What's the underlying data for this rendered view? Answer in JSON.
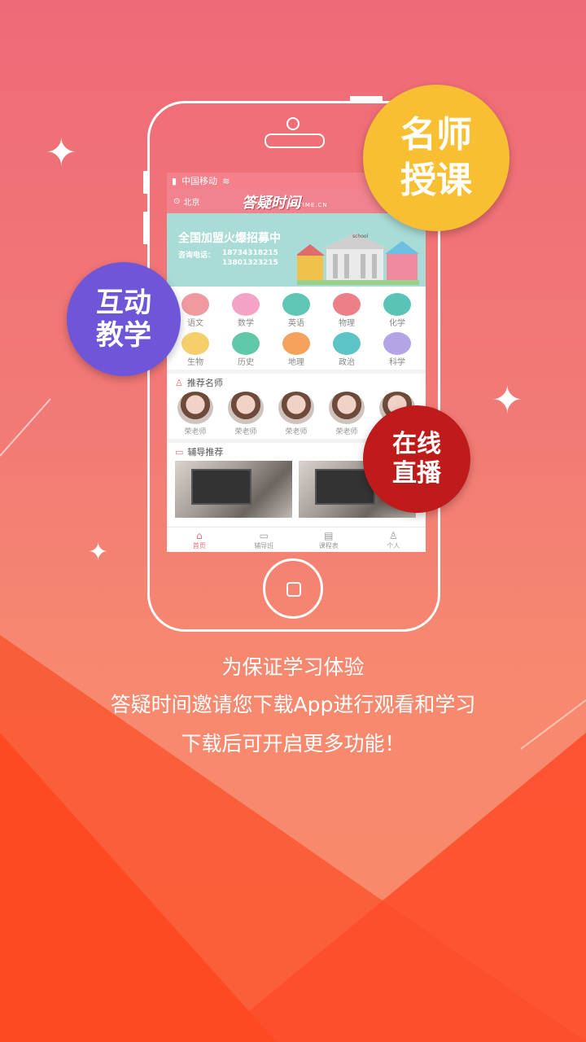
{
  "phone": {
    "status": {
      "carrier": "中国移动"
    },
    "header": {
      "city": "北京",
      "logo": "答疑时间",
      "logo_sub": "DATIME.CN"
    },
    "banner": {
      "title": "全国加盟火爆招募中",
      "phone_label": "咨询电话：",
      "phone1": "18734318215",
      "phone2": "13801323215",
      "school_label": "school"
    },
    "subjects": [
      {
        "label": "语文",
        "color": "#f09aa0"
      },
      {
        "label": "数学",
        "color": "#f4a3c6"
      },
      {
        "label": "英语",
        "color": "#5fc6b6"
      },
      {
        "label": "物理",
        "color": "#ec7f87"
      },
      {
        "label": "化学",
        "color": "#5bc3b6"
      },
      {
        "label": "生物",
        "color": "#f4cf6c"
      },
      {
        "label": "历史",
        "color": "#61c7a9"
      },
      {
        "label": "地理",
        "color": "#f4a25c"
      },
      {
        "label": "政治",
        "color": "#5cc4c6"
      },
      {
        "label": "科学",
        "color": "#b3a4e6"
      }
    ],
    "teachers_section": {
      "title": "推荐名师"
    },
    "teachers": [
      "荣老师",
      "荣老师",
      "荣老师",
      "荣老师",
      "荣老师"
    ],
    "tutor_section": {
      "title": "辅导推荐"
    },
    "tabs": [
      {
        "label": "首页",
        "icon": "home-icon"
      },
      {
        "label": "辅导班",
        "icon": "video-icon"
      },
      {
        "label": "课程表",
        "icon": "schedule-icon"
      },
      {
        "label": "个人",
        "icon": "person-icon"
      }
    ]
  },
  "badges": {
    "yellow": [
      "名师",
      "授课"
    ],
    "purple": [
      "互动",
      "教学"
    ],
    "red": [
      "在线",
      "直播"
    ]
  },
  "captions": [
    "为保证学习体验",
    "答疑时间邀请您下载App进行观看和学习",
    "下载后可开启更多功能！"
  ],
  "colors": {
    "accent": "#f0838d",
    "badge_yellow": "#f8bf33",
    "badge_purple": "#6f55d8",
    "badge_red": "#c01b1b"
  }
}
